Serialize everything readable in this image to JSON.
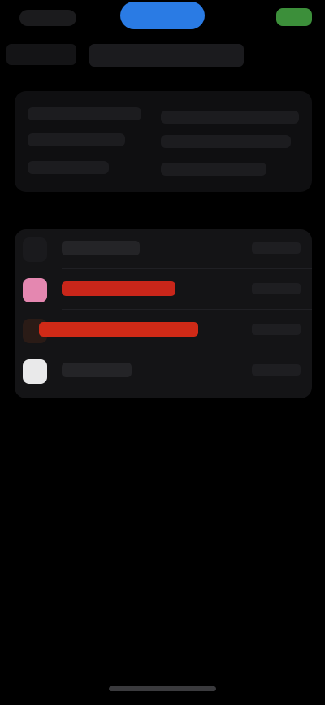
{
  "status_bar": {
    "time": "",
    "island_label": "",
    "battery_label": ""
  },
  "nav": {
    "back_label": "",
    "title": ""
  },
  "info_card": {
    "line1_left": "",
    "line1_right": "",
    "line2_left": "",
    "line2_right": "",
    "line3_left": "",
    "line3_right": ""
  },
  "list": {
    "items": [
      {
        "title": "",
        "value": "",
        "icon": "app-icon",
        "accent": "#1a1a1d"
      },
      {
        "title": "",
        "value": "",
        "icon": "pink-app-icon",
        "accent": "#e487b0"
      },
      {
        "title": "",
        "value": "",
        "icon": "red-app-icon",
        "accent": "#d02a17"
      },
      {
        "title": "",
        "value": "",
        "icon": "white-app-icon",
        "accent": "#e9e9ea"
      }
    ]
  },
  "colors": {
    "background": "#000000",
    "card": "#141416",
    "island_blue": "#2a7be4",
    "battery_green": "#3c8f3a",
    "highlight_red": "#d02a17"
  }
}
